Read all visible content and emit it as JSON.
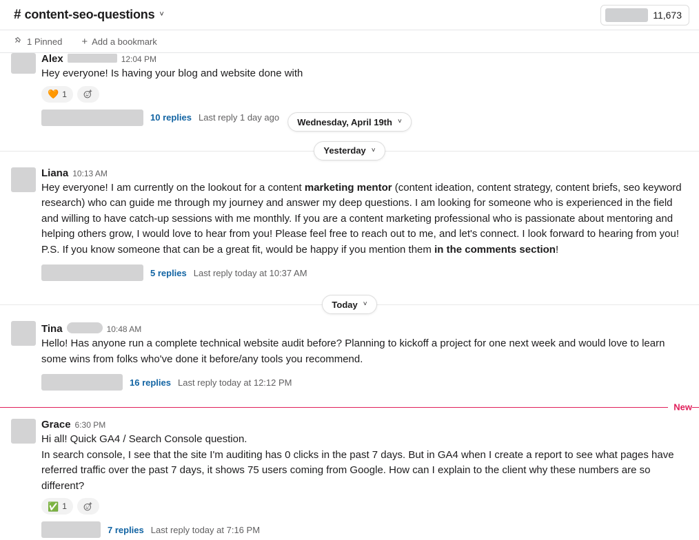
{
  "header": {
    "hash": "#",
    "channel_name": "content-seo-questions",
    "chevron": "˅",
    "members_count": "11,673"
  },
  "bookmark_bar": {
    "pin_icon": "pin-icon",
    "pinned_label": "1 Pinned",
    "plus_icon": "+",
    "add_bookmark_label": "Add a bookmark"
  },
  "dividers": {
    "wednesday": "Wednesday, April 19th",
    "yesterday": "Yesterday",
    "today": "Today",
    "new": "New",
    "chevron": "˅"
  },
  "colors": {
    "link": "#1264a3",
    "new_divider": "#e01e5a",
    "text": "#1d1c1d",
    "muted": "#616061",
    "redaction": "#d3d3d4"
  },
  "messages": [
    {
      "sender": "Alex",
      "name_redacted": true,
      "timestamp": "12:04 PM",
      "text": "Hey everyone! Is having your blog and website done with",
      "reaction_emoji": "🧡",
      "reaction_name": "orange-heart-emoji",
      "reaction_count": "1",
      "reply_count": "10 replies",
      "reply_meta": "Last reply 1 day ago"
    },
    {
      "sender": "Liana",
      "name_redacted": false,
      "timestamp": "10:13 AM",
      "text_part1": "Hey everyone! I am currently on the lookout for a content ",
      "text_bold1": "marketing mentor",
      "text_part2": " (content ideation, content strategy, content briefs, seo keyword research) who can guide me through my journey and answer my deep questions. I am looking for someone who is experienced in the field and willing to have catch-up sessions with me monthly. If you are a content marketing professional who is passionate about mentoring and helping others grow, I would love to hear from you! Please feel free to reach out to me, and let's connect. I look forward to hearing from you! P.S. If you know someone that can be a great fit, would be happy if you mention them ",
      "text_bold2": "in the comments section",
      "text_part3": "!",
      "reply_count": "5 replies",
      "reply_meta": "Last reply today at 10:37 AM"
    },
    {
      "sender": "Tina",
      "name_redacted": true,
      "timestamp": "10:48 AM",
      "text": "Hello! Has anyone run a complete technical website audit before? Planning to kickoff a project for one next week and would love to learn some wins from folks who've done it before/any tools you recommend.",
      "reply_count": "16 replies",
      "reply_meta": "Last reply today at 12:12 PM"
    },
    {
      "sender": "Grace",
      "name_redacted": false,
      "timestamp": "6:30 PM",
      "text_line1": "Hi all! Quick GA4 / Search Console question.",
      "text_line2": "In search console, I see that the site I'm auditing has 0 clicks in the past 7 days. But in GA4 when I create a report to see what pages have referred traffic over the past 7 days, it shows 75 users coming from Google. How can I explain to the client why these numbers are so different?",
      "reaction_emoji": "✅",
      "reaction_name": "white-check-mark-emoji",
      "reaction_count": "1",
      "reply_count": "7 replies",
      "reply_meta": "Last reply today at 7:16 PM"
    }
  ]
}
